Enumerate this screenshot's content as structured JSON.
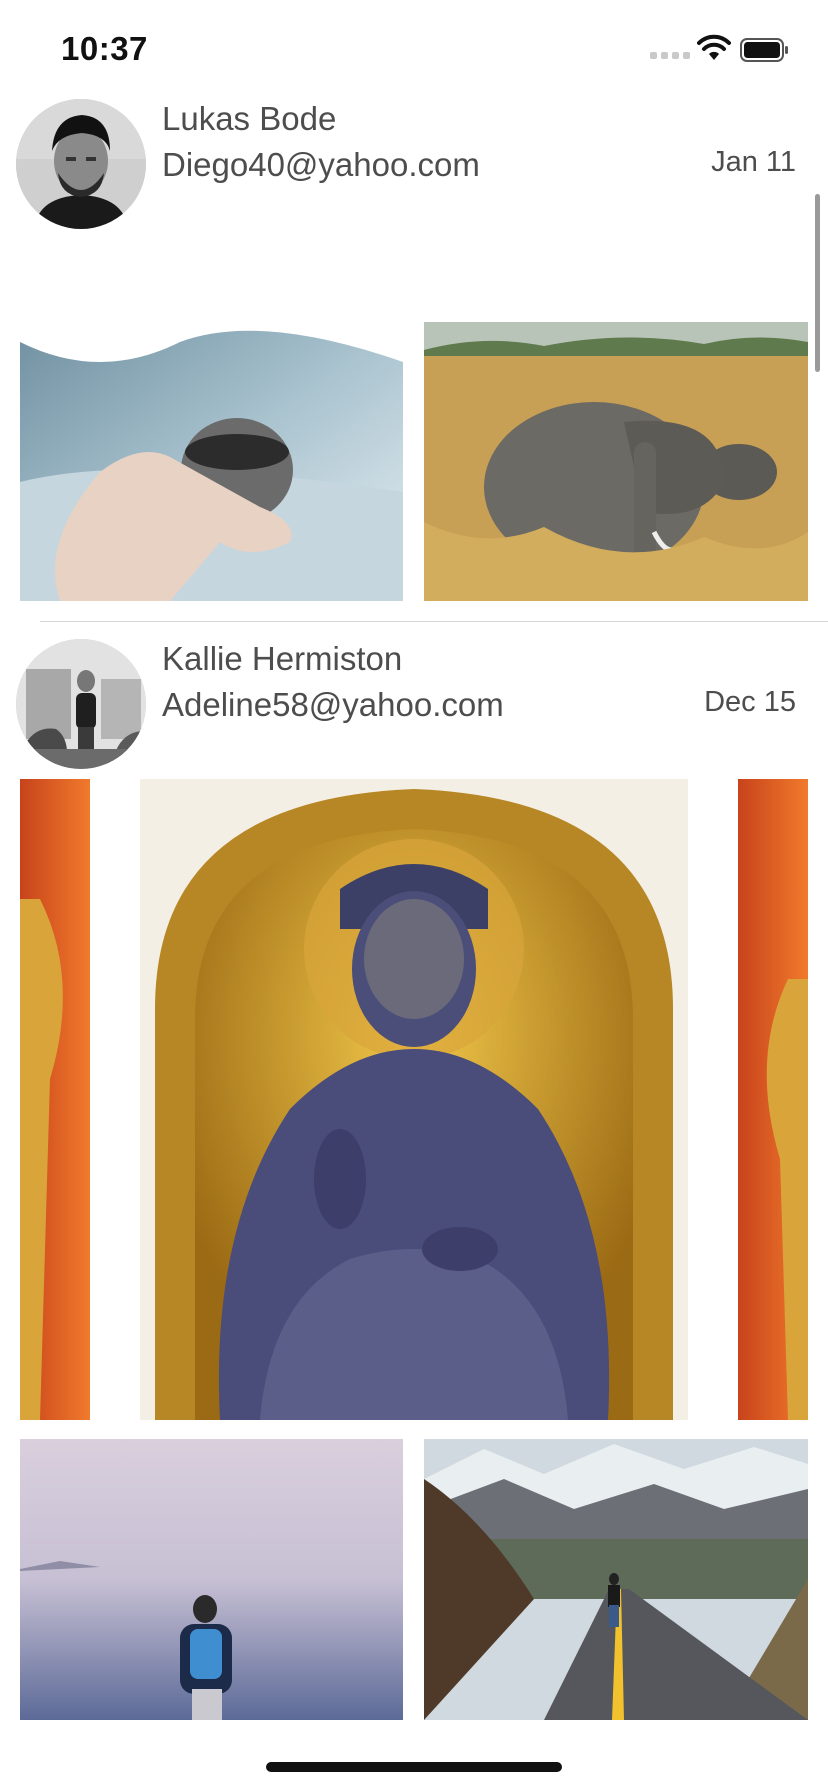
{
  "status_bar": {
    "time": "10:37",
    "icons": [
      "signal-icon",
      "wifi-icon",
      "battery-icon"
    ]
  },
  "posts": [
    {
      "name": "Lukas Bode",
      "email": "Diego40@yahoo.com",
      "date": "Jan 11",
      "avatar": "avatar-man-bearded",
      "photos": [
        "photo-hand-holding-cup-mountains",
        "photo-elephant-savanna"
      ]
    },
    {
      "name": "Kallie Hermiston",
      "email": "Adeline58@yahoo.com",
      "date": "Dec 15",
      "avatar": "avatar-woman-city",
      "photos": [
        "photo-golden-buddha-statue",
        "photo-man-backpack-misty-lake",
        "photo-man-walking-road-mountains"
      ]
    }
  ],
  "colors": {
    "background": "#ffffff",
    "text": "#4d4d4d",
    "divider": "#d6d6d6",
    "scrollbar": "#9a9a9a"
  }
}
